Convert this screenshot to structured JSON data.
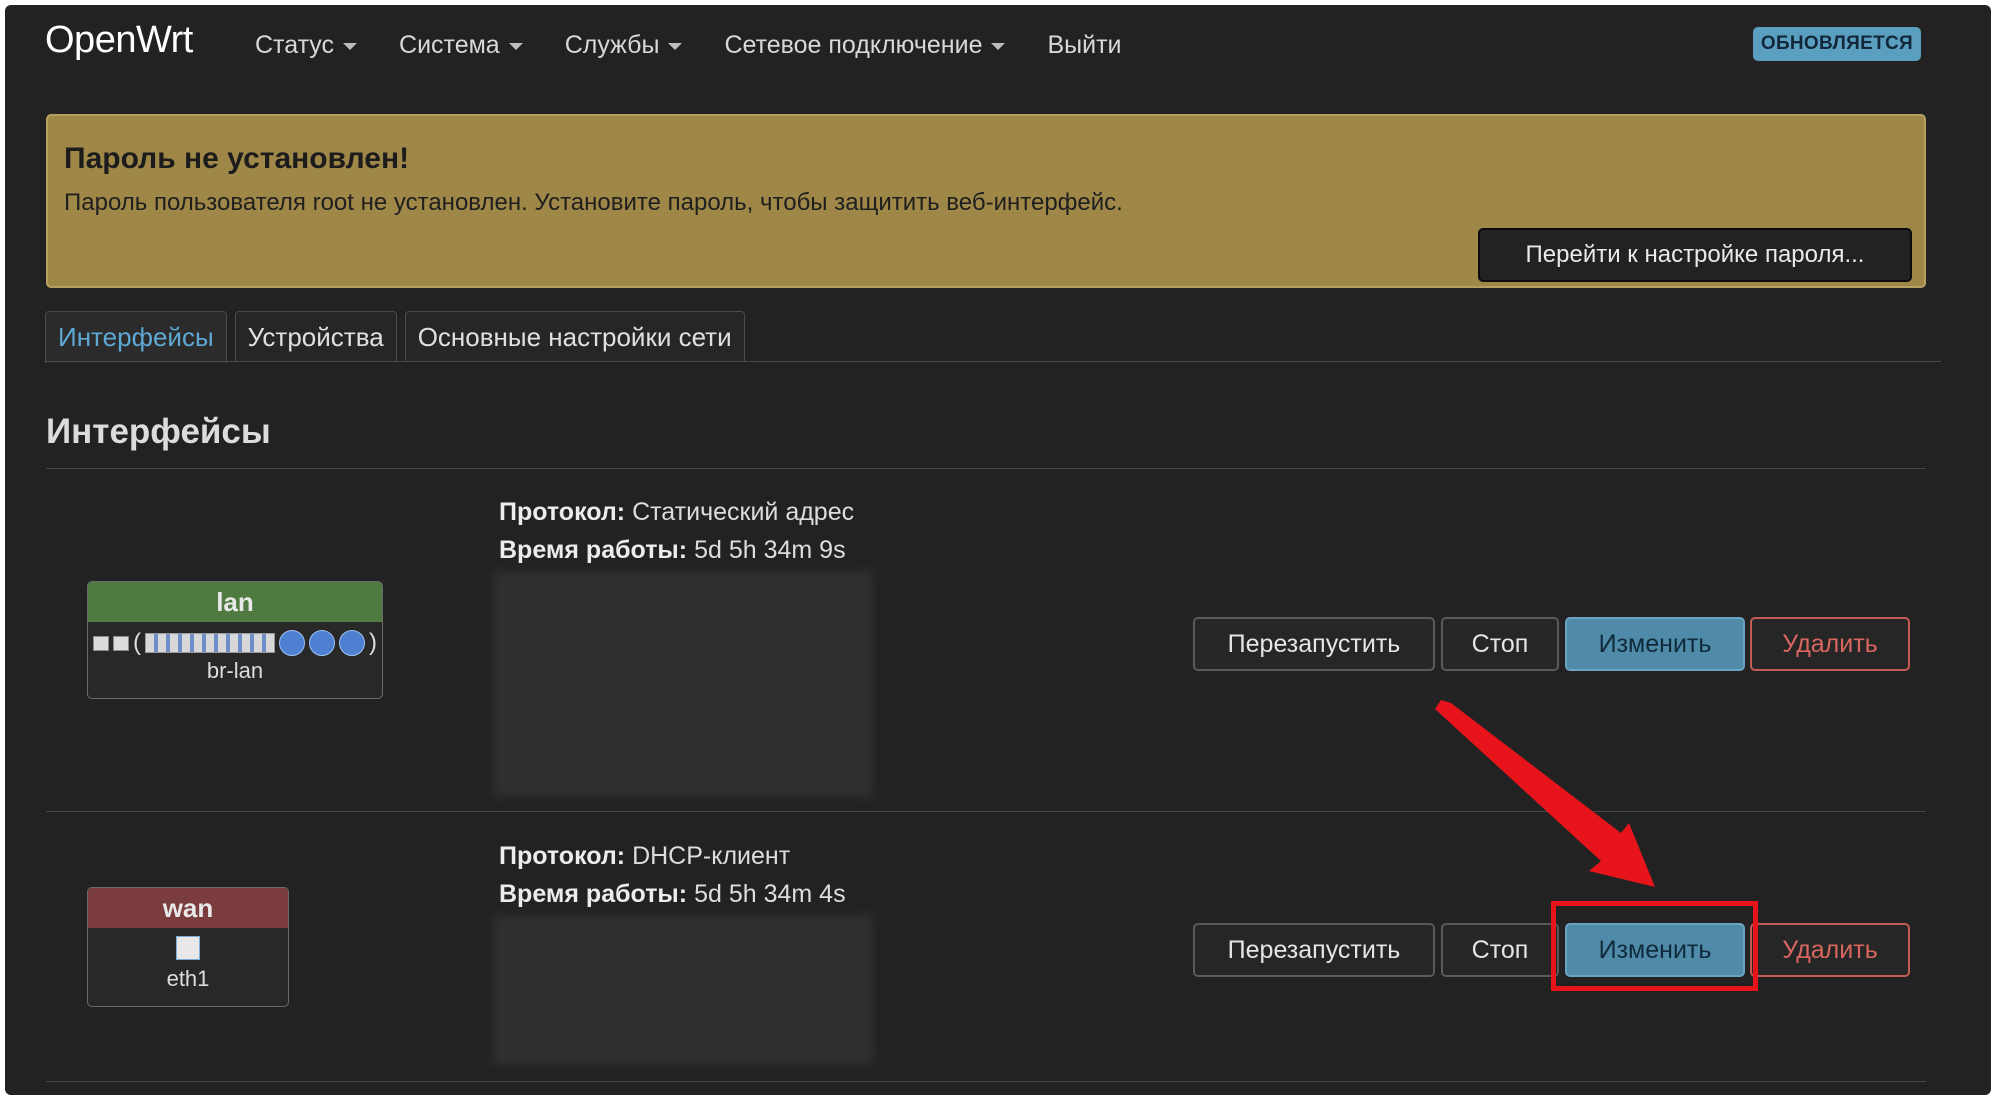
{
  "brand": "OpenWrt",
  "nav": {
    "items": [
      "Статус",
      "Система",
      "Службы",
      "Сетевое подключение"
    ],
    "logout": "Выйти",
    "badge": "ОБНОВЛЯЕТСЯ"
  },
  "alert": {
    "title": "Пароль не установлен!",
    "text": "Пароль пользователя root не установлен. Установите пароль, чтобы защитить веб-интерфейс.",
    "button": "Перейти к настройке пароля..."
  },
  "tabs": [
    "Интерфейсы",
    "Устройства",
    "Основные настройки сети"
  ],
  "section_title": "Интерфейсы",
  "labels": {
    "protocol": "Протокол:",
    "uptime": "Время работы:"
  },
  "interfaces": [
    {
      "name": "lan",
      "device": "br-lan",
      "header_color": "#4f7a40",
      "protocol": "Статический адрес",
      "uptime": "5d 5h 34m 9s",
      "buttons": {
        "restart": "Перезапустить",
        "stop": "Стоп",
        "edit": "Изменить",
        "delete": "Удалить"
      }
    },
    {
      "name": "wan",
      "device": "eth1",
      "header_color": "#7a3c3c",
      "protocol": "DHCP-клиент",
      "uptime": "5d 5h 34m 4s",
      "buttons": {
        "restart": "Перезапустить",
        "stop": "Стоп",
        "edit": "Изменить",
        "delete": "Удалить"
      }
    }
  ]
}
